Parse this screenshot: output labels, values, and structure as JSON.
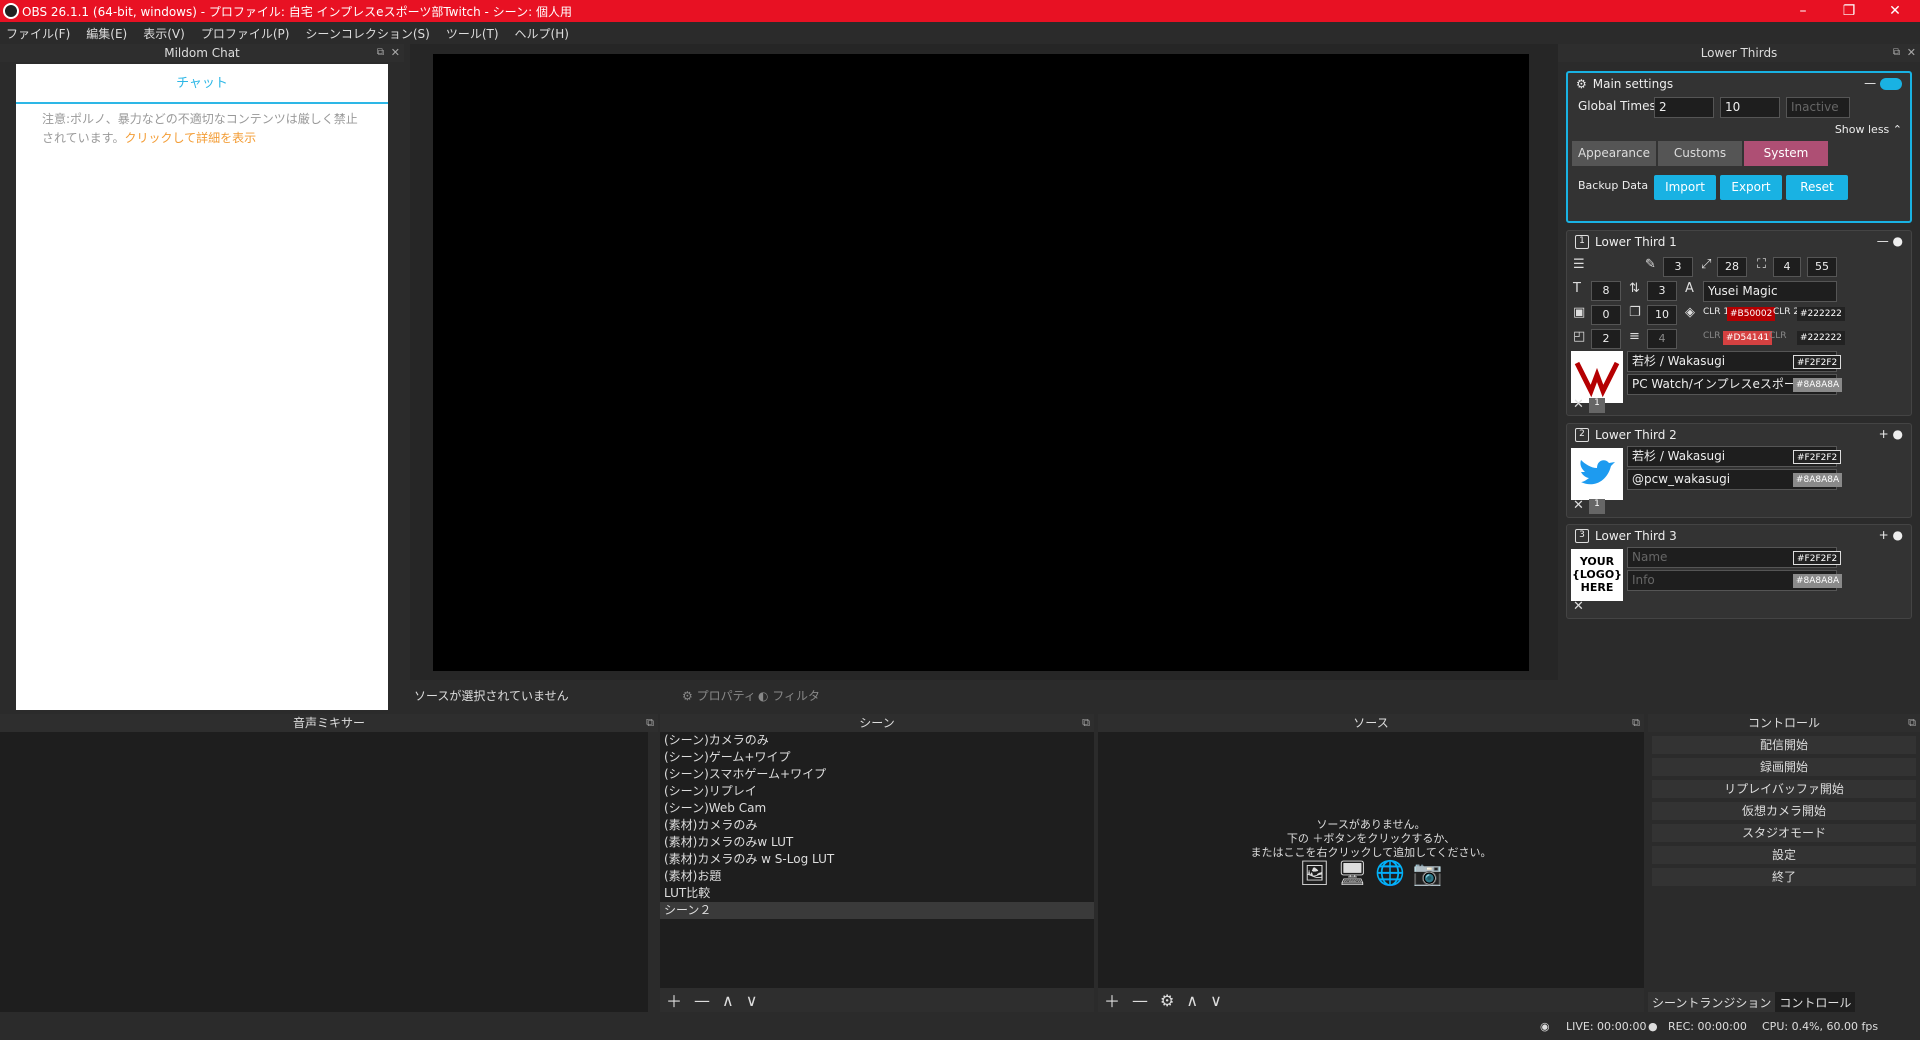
{
  "window": {
    "title": "OBS 26.1.1 (64-bit, windows) - プロファイル: 自宅 インプレスeスポーツ部Twitch - シーン: 個人用",
    "minimize": "–",
    "maximize": "❐",
    "close": "✕"
  },
  "menu": [
    "ファイル(F)",
    "編集(E)",
    "表示(V)",
    "プロファイル(P)",
    "シーンコレクション(S)",
    "ツール(T)",
    "ヘルプ(H)"
  ],
  "chat": {
    "title": "Mildom Chat",
    "tab": "チャット",
    "notice": "注意:ポルノ、暴力などの不適切なコンテンツは厳しく禁止されています。",
    "notice_link": "クリックして詳細を表示"
  },
  "preview": {
    "no_source": "ソースが選択されていません",
    "properties": "プロパティ",
    "filters": "フィルタ"
  },
  "lower_thirds": {
    "title": "Lower Thirds",
    "main": {
      "title": "Main settings",
      "global_times_label": "Global Times",
      "global_times_1": "2",
      "global_times_2": "10",
      "inactive": "Inactive",
      "show_less": "Show less",
      "tabs": [
        "Appearance",
        "Customs",
        "System"
      ],
      "backup_label": "Backup Data",
      "import": "Import",
      "export": "Export",
      "reset": "Reset"
    },
    "lt1": {
      "title": "Lower Third 1",
      "v1": "3",
      "v2": "28",
      "v3": "4",
      "v4": "55",
      "v5": "8",
      "v6": "3",
      "font": "Yusei Magic",
      "v7": "0",
      "v8": "10",
      "clr1_label": "CLR 1",
      "clr1": "#B50002",
      "clr2_label": "CLR 2",
      "clr2": "#222222",
      "v9": "2",
      "v10": "4",
      "clr3_label": "CLR",
      "clr3": "#D54141",
      "clr4_label": "CLR",
      "clr4": "#222222",
      "name": "若杉 / Wakasugi",
      "name_color": "#F2F2F2",
      "info": "PC Watch/インプレスeスポー",
      "info_color": "#8A8A8A",
      "slot": "1"
    },
    "lt2": {
      "title": "Lower Third 2",
      "name": "若杉 / Wakasugi",
      "name_color": "#F2F2F2",
      "info": "@pcw_wakasugi",
      "info_color": "#8A8A8A",
      "slot": "1"
    },
    "lt3": {
      "title": "Lower Third 3",
      "name_ph": "Name",
      "name_color": "#F2F2F2",
      "info_ph": "Info",
      "info_color": "#8A8A8A",
      "logo_text": "YOUR\n{LOGO}\nHERE"
    }
  },
  "docks": {
    "mixer": "音声ミキサー",
    "scenes": "シーン",
    "sources": "ソース",
    "controls": "コントロール"
  },
  "scenes": [
    "(シーン)カメラのみ",
    "(シーン)ゲーム+ワイプ",
    "(シーン)スマホゲーム+ワイプ",
    "(シーン)リプレイ",
    "(シーン)Web Cam",
    "(素材)カメラのみ",
    "(素材)カメラのみw LUT",
    "(素材)カメラのみ w S-Log LUT",
    "(素材)お題",
    "LUT比較",
    "シーン２"
  ],
  "sources_empty": [
    "ソースがありません。",
    "下の ＋ボタンをクリックするか、",
    "またはここを右クリックして追加してください。"
  ],
  "controls": [
    "配信開始",
    "録画開始",
    "リプレイバッファ開始",
    "仮想カメラ開始",
    "スタジオモード",
    "設定",
    "終了"
  ],
  "bottom_tabs": [
    "シーントランジション",
    "コントロール"
  ],
  "status": {
    "live": "LIVE: 00:00:00",
    "rec": "REC: 00:00:00",
    "cpu": "CPU: 0.4%, 60.00 fps"
  }
}
